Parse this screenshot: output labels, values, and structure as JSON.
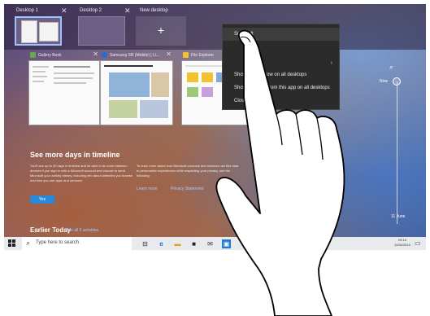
{
  "desktops": [
    {
      "label": "Desktop 1",
      "active": true
    },
    {
      "label": "Desktop 2",
      "active": false
    },
    {
      "label": "New desktop",
      "plus": "+"
    }
  ],
  "windows": [
    {
      "title": "Gallery Book",
      "icon_color": "#6aa84f"
    },
    {
      "title": "Samsung SR (Mobile) | Li...",
      "icon_color": "#1e6fd9"
    },
    {
      "title": "File Explorer",
      "icon_color": "#f2c12e"
    }
  ],
  "context_menu": {
    "items": [
      {
        "label": "Snap left"
      },
      {
        "label": "Show this window on all desktops"
      },
      {
        "label": "Show windows from this app on all desktops"
      },
      {
        "label": "Close"
      }
    ]
  },
  "timeline_promo": {
    "title": "See more days in timeline",
    "body": "You'll see up to 30 days in timeline and be able to do more between devices if you sign in with a Microsoft account and choose to send Microsoft your activity history, including info about websites you browse and how you use apps and services.",
    "side": "To learn more about how Microsoft products and services use this data to personalize experiences while respecting your privacy, see the following:",
    "learn_more": "Learn more",
    "privacy": "Privacy Statement",
    "yes_button": "Yes"
  },
  "timeline": {
    "now_label": "Now",
    "date_label": "11 June"
  },
  "earlier_today": {
    "title": "Earlier Today",
    "see_all": "See all 6 activities"
  },
  "taskbar": {
    "search_placeholder": "Type here to search",
    "clock_time": "09:16",
    "clock_date": "11/06/2019"
  },
  "colors": {
    "accent": "#2a88d8",
    "taskbar": "#e9eaee",
    "menu": "#2b2b2b"
  }
}
